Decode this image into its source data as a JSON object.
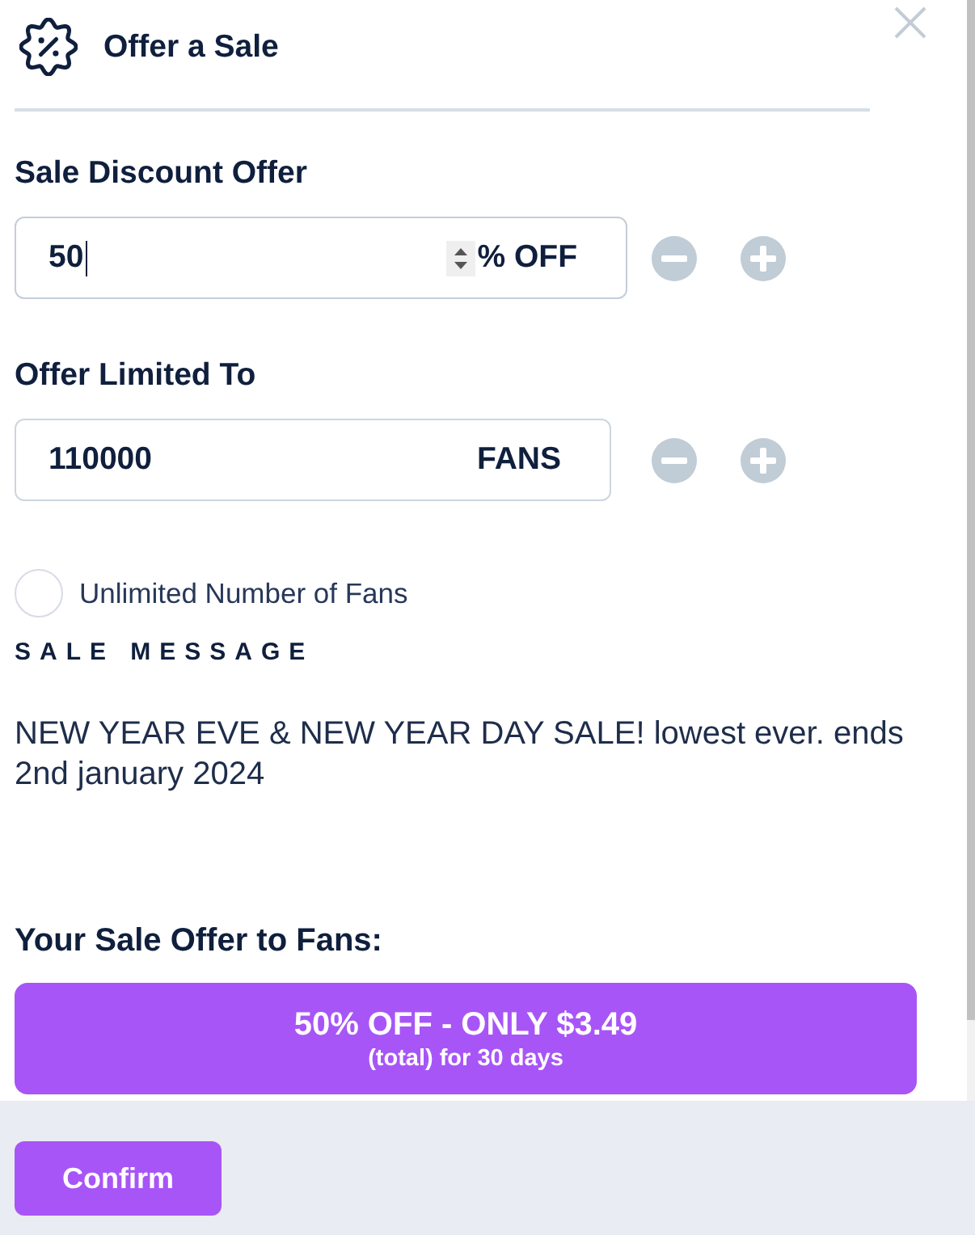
{
  "header": {
    "title": "Offer a Sale"
  },
  "discount": {
    "label": "Sale Discount Offer",
    "value": "50",
    "unit": "% OFF",
    "focused": true
  },
  "limit": {
    "label": "Offer Limited To",
    "value": "110000",
    "unit": "FANS",
    "focused": false
  },
  "unlimited": {
    "label": "Unlimited Number of Fans",
    "checked": false
  },
  "message": {
    "heading": "SALE MESSAGE",
    "value": "NEW YEAR EVE & NEW YEAR DAY SALE! lowest ever. ends 2nd january 2024"
  },
  "preview": {
    "heading": "Your Sale Offer to Fans:",
    "headline": "50% OFF - ONLY $3.49",
    "subline": "(total) for 30 days"
  },
  "footer": {
    "confirm": "Confirm"
  }
}
